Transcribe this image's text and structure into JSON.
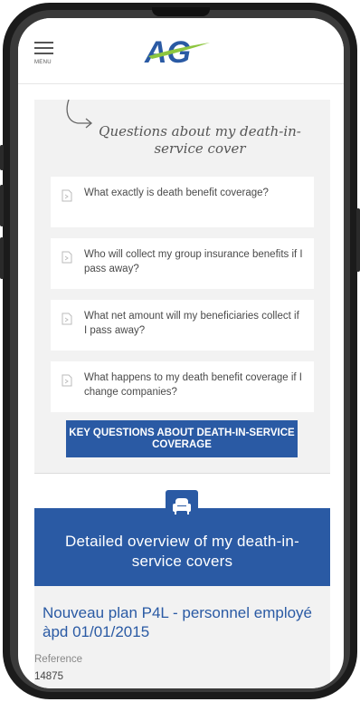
{
  "header": {
    "menu_label": "MENU",
    "logo_text": "AG"
  },
  "faq": {
    "title": "Questions about my death-in-service cover",
    "items": [
      {
        "question": "What exactly is death benefit coverage?"
      },
      {
        "question": "Who will collect my group insurance benefits if I pass away?"
      },
      {
        "question": "What net amount will my beneficiaries collect if I pass away?"
      },
      {
        "question": "What happens to my death benefit coverage if I change companies?"
      }
    ],
    "button_label": "KEY QUESTIONS ABOUT DEATH-IN-SERVICE COVERAGE"
  },
  "overview": {
    "icon": "armchair-icon",
    "title": "Detailed overview of my death-in-service covers"
  },
  "plan": {
    "name": "Nouveau plan P4L - personnel employé àpd 01/01/2015",
    "reference_label": "Reference",
    "reference_value": "14875"
  },
  "colors": {
    "brand_blue": "#2a5aa4",
    "logo_green": "#8dc63f",
    "panel_grey": "#f2f2f2"
  }
}
